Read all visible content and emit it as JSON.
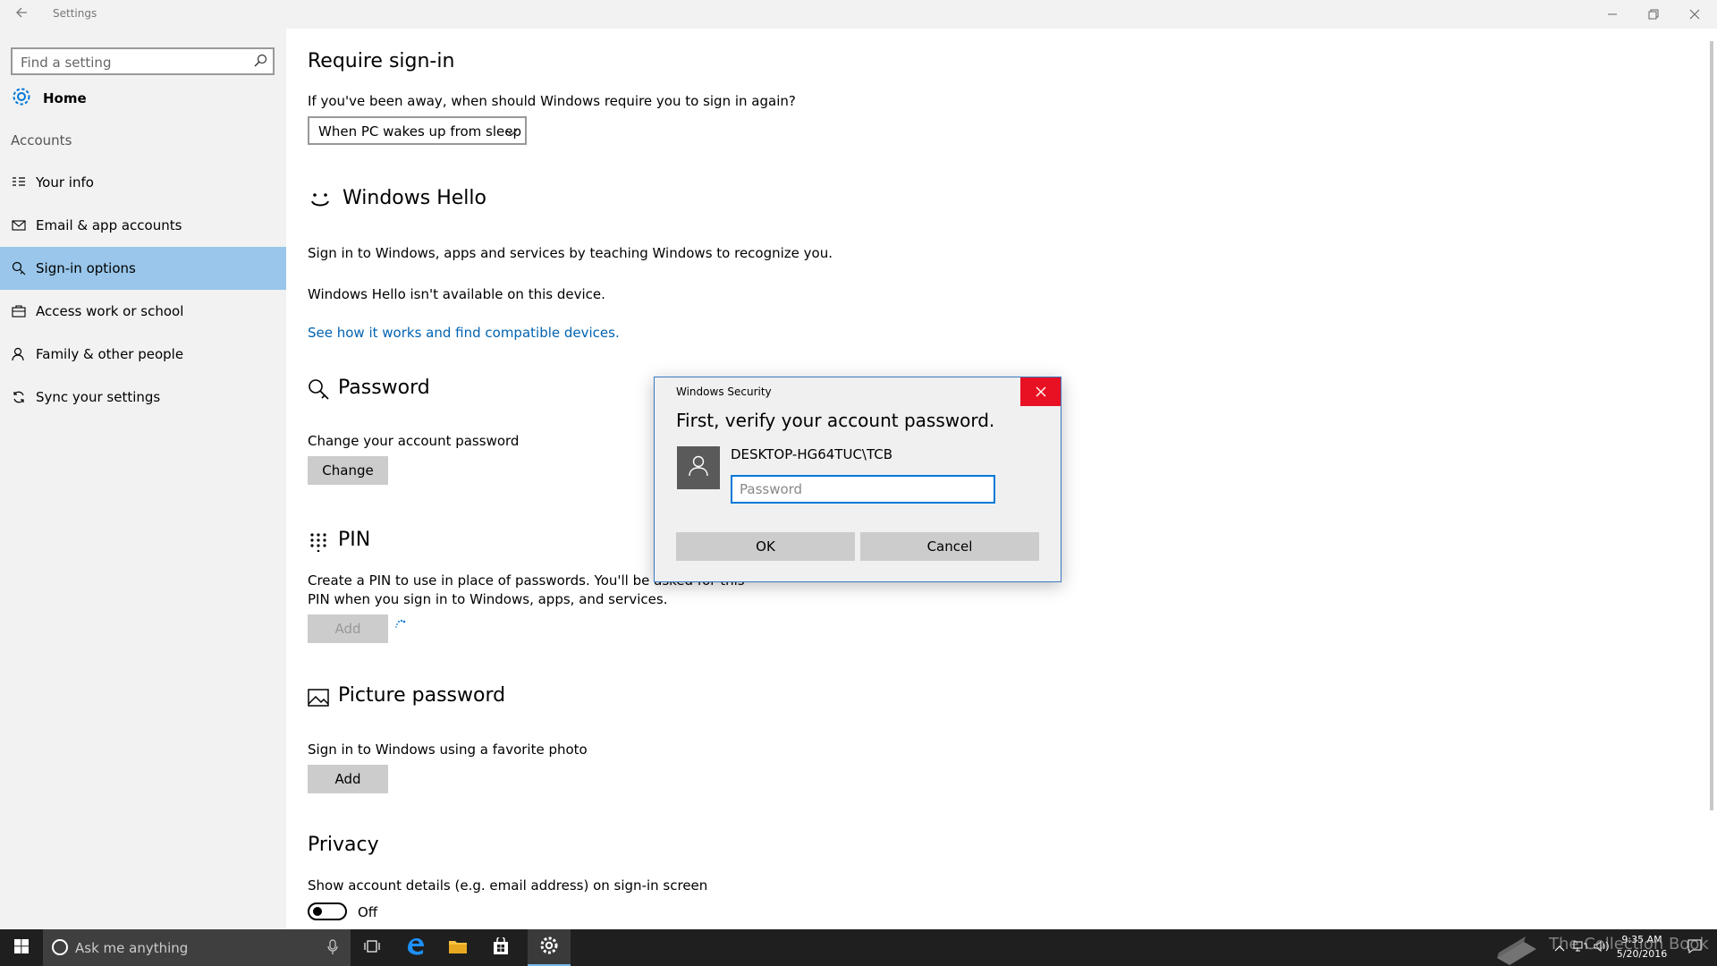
{
  "window": {
    "title": "Settings"
  },
  "sidebar": {
    "search_placeholder": "Find a setting",
    "home_label": "Home",
    "group_title": "Accounts",
    "items": [
      {
        "label": "Your info",
        "icon": "contact-info-icon"
      },
      {
        "label": "Email & app accounts",
        "icon": "mail-icon"
      },
      {
        "label": "Sign-in options",
        "icon": "key-icon",
        "selected": true
      },
      {
        "label": "Access work or school",
        "icon": "briefcase-icon"
      },
      {
        "label": "Family & other people",
        "icon": "person-icon"
      },
      {
        "label": "Sync your settings",
        "icon": "sync-icon"
      }
    ]
  },
  "main": {
    "require_signin": {
      "title": "Require sign-in",
      "question": "If you've been away, when should Windows require you to sign in again?",
      "selected": "When PC wakes up from sleep"
    },
    "hello": {
      "title": "Windows Hello",
      "desc": "Sign in to Windows, apps and services by teaching Windows to recognize you.",
      "unavailable": "Windows Hello isn't available on this device.",
      "link": "See how it works and find compatible devices."
    },
    "password": {
      "title": "Password",
      "desc": "Change your account password",
      "button": "Change"
    },
    "pin": {
      "title": "PIN",
      "desc_line1": "Create a PIN to use in place of passwords. You'll be asked for this",
      "desc_line2": "PIN when you sign in to Windows, apps, and services.",
      "button": "Add"
    },
    "picture": {
      "title": "Picture password",
      "desc": "Sign in to Windows using a favorite photo",
      "button": "Add"
    },
    "privacy": {
      "title": "Privacy",
      "desc": "Show account details (e.g. email address) on sign-in screen",
      "toggle_state": "Off"
    }
  },
  "dialog": {
    "title": "Windows Security",
    "heading": "First, verify your account password.",
    "account": "DESKTOP-HG64TUC\\TCB",
    "password_placeholder": "Password",
    "ok": "OK",
    "cancel": "Cancel"
  },
  "taskbar": {
    "search_placeholder": "Ask me anything",
    "time": "9:35 AM",
    "date": "5/20/2016",
    "watermark": "The Collection Book"
  },
  "colors": {
    "accent": "#0078d7",
    "selected_nav": "#99c6ea",
    "link": "#0063b1",
    "close_red": "#e81123"
  }
}
